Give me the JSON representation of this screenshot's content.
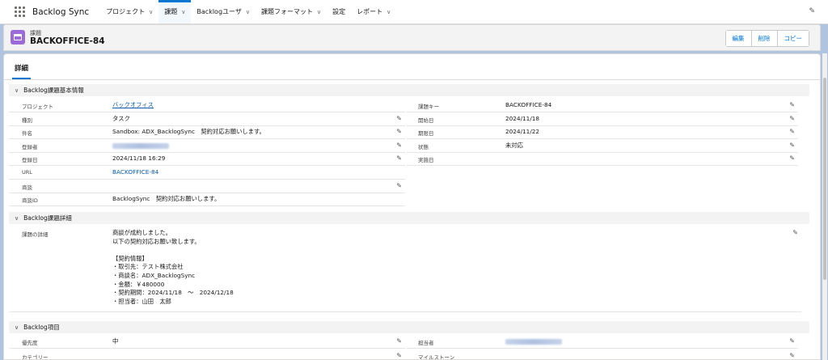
{
  "nav": {
    "app_name": "Backlog Sync",
    "items": [
      {
        "label": "プロジェクト",
        "chevron": true
      },
      {
        "label": "課題",
        "chevron": true,
        "active": true
      },
      {
        "label": "Backlogユーザ",
        "chevron": true
      },
      {
        "label": "課題フォーマット",
        "chevron": true
      },
      {
        "label": "設定",
        "chevron": false
      },
      {
        "label": "レポート",
        "chevron": true
      }
    ]
  },
  "record": {
    "type_label": "課題",
    "title": "BACKOFFICE-84",
    "buttons": [
      "編集",
      "削除",
      "コピー"
    ]
  },
  "tabs": {
    "details": "詳細"
  },
  "sections": {
    "basic": "Backlog課題基本情報",
    "detail": "Backlog課題詳細",
    "items": "Backlog項目"
  },
  "basic_left": [
    {
      "label": "プロジェクト",
      "value": "バックオフィス",
      "link": true,
      "edit": false
    },
    {
      "label": "種別",
      "value": "タスク",
      "edit": true
    },
    {
      "label": "件名",
      "value": "Sandbox: ADX_BacklogSync　契約対応お願いします。",
      "edit": true
    },
    {
      "label": "登録者",
      "value": "",
      "blurred": true,
      "edit": true
    },
    {
      "label": "登録日",
      "value": "2024/11/18 16:29",
      "edit": true
    },
    {
      "label": "URL",
      "value": "BACKOFFICE-84",
      "link": true,
      "edit": false
    },
    {
      "label": "商談",
      "value": "",
      "edit": true
    },
    {
      "label": "商談ID",
      "value": "BacklogSync　契約対応お願いします。",
      "edit": false
    }
  ],
  "basic_right": [
    {
      "label": "課題キー",
      "value": "BACKOFFICE-84",
      "edit": true
    },
    {
      "label": "開始日",
      "value": "2024/11/18",
      "edit": true
    },
    {
      "label": "期限日",
      "value": "2024/11/22",
      "edit": true
    },
    {
      "label": "状態",
      "value": "未対応",
      "edit": true
    },
    {
      "label": "実施日",
      "value": "",
      "edit": true
    }
  ],
  "detail": {
    "label": "課題の詳細",
    "lines": [
      "商談が成約しました。",
      "以下の契約対応お願い致します。",
      "",
      "【契約情報】",
      "・取引先：テスト株式会社",
      "・商談名：ADX_BacklogSync",
      "・金額：￥480000",
      "・契約期間：2024/11/18　～　2024/12/18",
      "・担当者：山田　太郎"
    ]
  },
  "items_left": [
    {
      "label": "優先度",
      "value": "中",
      "edit": true
    },
    {
      "label": "カテゴリー",
      "value": "",
      "edit": true
    }
  ],
  "items_right": [
    {
      "label": "担当者",
      "value": "",
      "blurred": true,
      "edit": true
    },
    {
      "label": "マイルストーン",
      "value": "",
      "edit": true
    }
  ],
  "icons": {
    "edit": "pencil-icon",
    "app": "waffle-icon",
    "record": "record-type-icon"
  }
}
